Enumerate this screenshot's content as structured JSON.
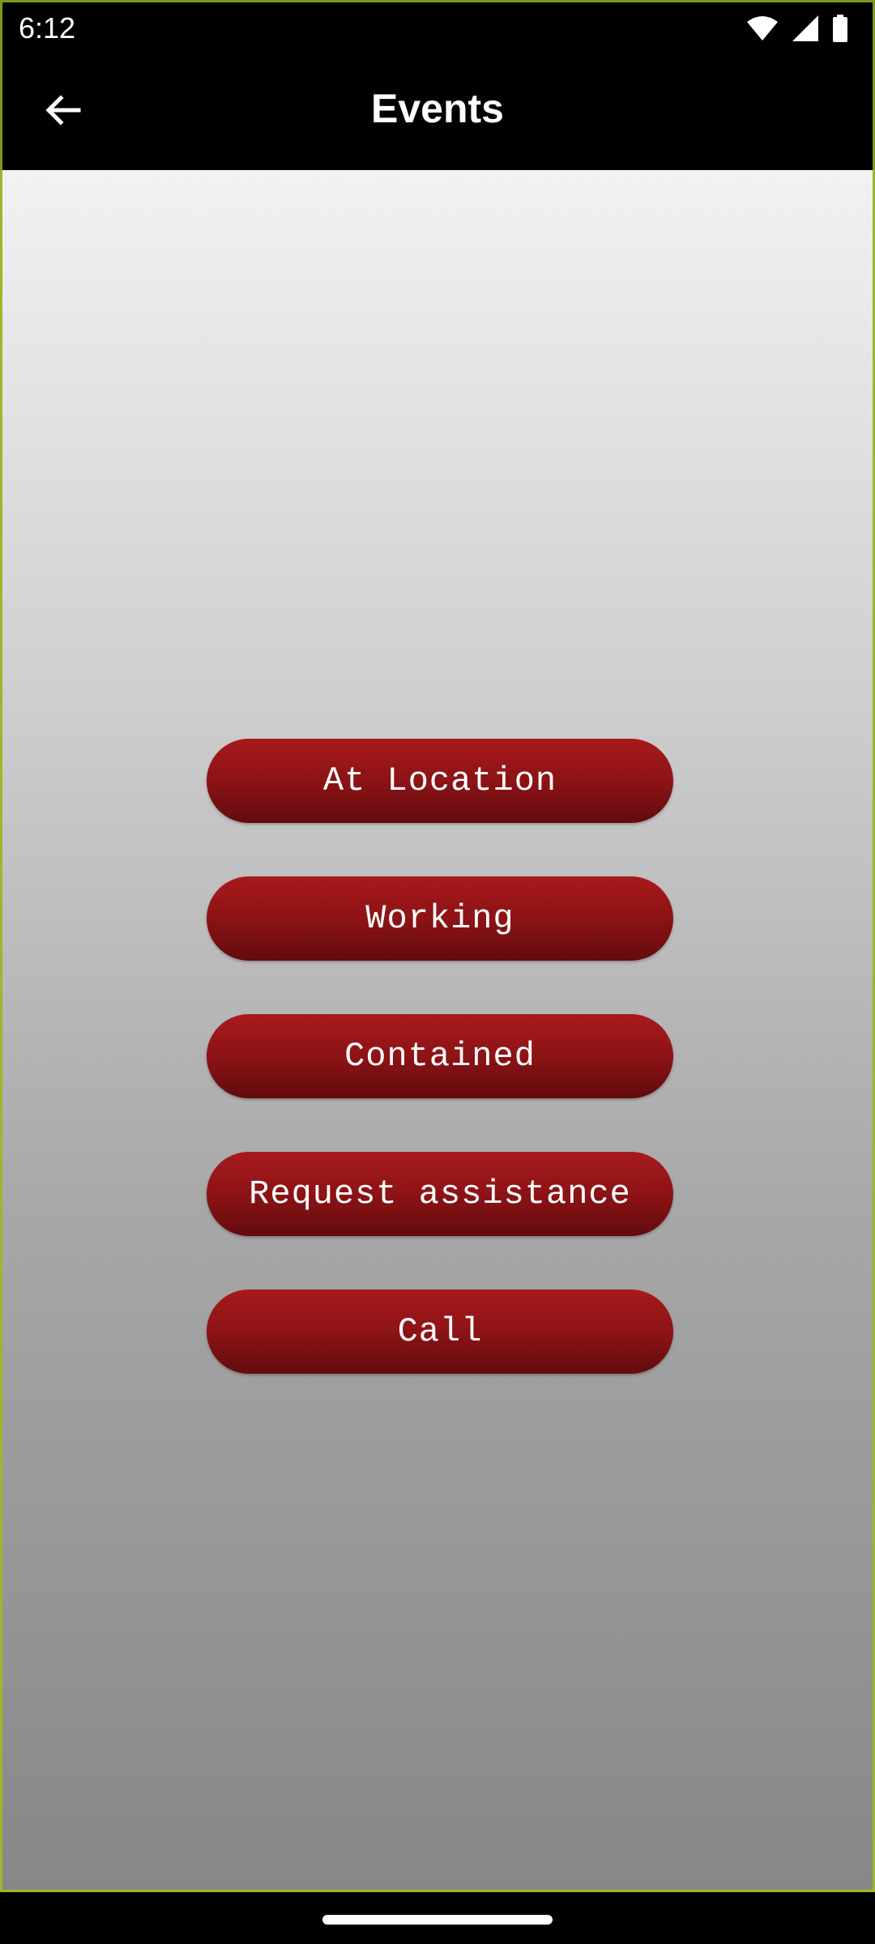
{
  "status_bar": {
    "time": "6:12",
    "icons": [
      "wifi-icon",
      "cellular-signal-icon",
      "battery-icon"
    ]
  },
  "app_bar": {
    "back_icon": "arrow-left-icon",
    "title": "Events"
  },
  "events": {
    "buttons": [
      {
        "label": "At Location"
      },
      {
        "label": "Working"
      },
      {
        "label": "Contained"
      },
      {
        "label": "Request assistance"
      },
      {
        "label": "Call"
      }
    ]
  },
  "colors": {
    "button_top": "#a81a1c",
    "button_bottom": "#630b0e",
    "background_top": "#f2f2f2",
    "background_bottom": "#878787",
    "app_bar": "#000000"
  }
}
